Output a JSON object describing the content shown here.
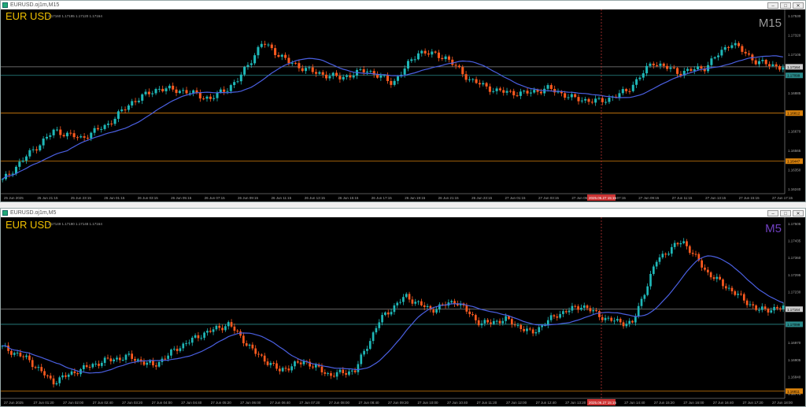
{
  "colors": {
    "bull": "#1fb8b8",
    "bear": "#ff5a1f",
    "ma": "#4a5fe0",
    "grid_red": "#b33",
    "orange_line": "#d9820d",
    "symbol_text": "#f0c000",
    "tf_top": "#999999",
    "tf_bottom": "#7040c0"
  },
  "windows": [
    {
      "title": "EURUSD.oj1m,M15",
      "symbol": "EUR USD",
      "timeframe": "M15",
      "ohlc": "1.17160 1.17195 1.17120 1.17164",
      "window_buttons": [
        "–",
        "□",
        "✕"
      ],
      "price_labels": [
        "1.17530",
        "1.17320",
        "1.17105",
        "1.16995",
        "1.16885",
        "1.16780",
        "1.16670",
        "1.16565",
        "1.16350",
        "1.16240"
      ],
      "badges": [
        {
          "text": "1.17164",
          "kind": "bid",
          "y": 1.17164
        },
        {
          "text": "1.17099",
          "kind": "ask",
          "y": 1.17099
        },
        {
          "text": "1.16812",
          "kind": "orange",
          "y": 1.16812
        },
        {
          "text": "1.16447",
          "kind": "orange",
          "y": 1.16447
        }
      ],
      "time_labels": [
        "25 Jun 2025",
        "25 Jun 21:15",
        "25 Jun 23:15",
        "26 Jun 01:15",
        "26 Jun 03:15",
        "26 Jun 05:15",
        "26 Jun 07:15",
        "26 Jun 09:15",
        "26 Jun 11:15",
        "26 Jun 13:15",
        "26 Jun 15:15",
        "26 Jun 17:15",
        "26 Jun 19:15",
        "26 Jun 21:15",
        "26 Jun 23:15",
        "27 Jun 01:15",
        "27 Jun 03:15",
        "27 Jun 05:15",
        "27 Jun 07:15",
        "27 Jun 09:15",
        "27 Jun 11:15",
        "27 Jun 13:15",
        "27 Jun 15:15",
        "27 Jun 17:15"
      ],
      "cursor_time": "2025.06.27 15:15"
    },
    {
      "title": "EURUSD.oj1m,M5",
      "symbol": "EUR USD",
      "timeframe": "M5",
      "ohlc": "1.17149 1.17190 1.17148 1.17164",
      "window_buttons": [
        "–",
        "□",
        "✕"
      ],
      "price_labels": [
        "1.17505",
        "1.17435",
        "1.17360",
        "1.17295",
        "1.17230",
        "1.17100",
        "1.17035",
        "1.16970",
        "1.16905",
        "1.16840",
        "1.16775"
      ],
      "badges": [
        {
          "text": "1.17164",
          "kind": "bid",
          "y": 1.17164
        },
        {
          "text": "1.17099",
          "kind": "ask",
          "y": 1.17099
        },
        {
          "text": "1.16811",
          "kind": "orange",
          "y": 1.16811
        }
      ],
      "time_labels": [
        "27 Jun 2025",
        "27 Jun 01:20",
        "27 Jun 02:00",
        "27 Jun 02:40",
        "27 Jun 03:20",
        "27 Jun 04:00",
        "27 Jun 04:40",
        "27 Jun 05:20",
        "27 Jun 06:00",
        "27 Jun 06:40",
        "27 Jun 07:20",
        "27 Jun 08:00",
        "27 Jun 08:40",
        "27 Jun 09:20",
        "27 Jun 10:00",
        "27 Jun 10:40",
        "27 Jun 11:20",
        "27 Jun 12:00",
        "27 Jun 12:40",
        "27 Jun 13:20",
        "27 Jun 14:00",
        "27 Jun 14:40",
        "27 Jun 15:20",
        "27 Jun 16:00",
        "27 Jun 16:40",
        "27 Jun 17:20",
        "27 Jun 18:00"
      ],
      "cursor_time": "2025.06.27 15:15"
    }
  ]
}
